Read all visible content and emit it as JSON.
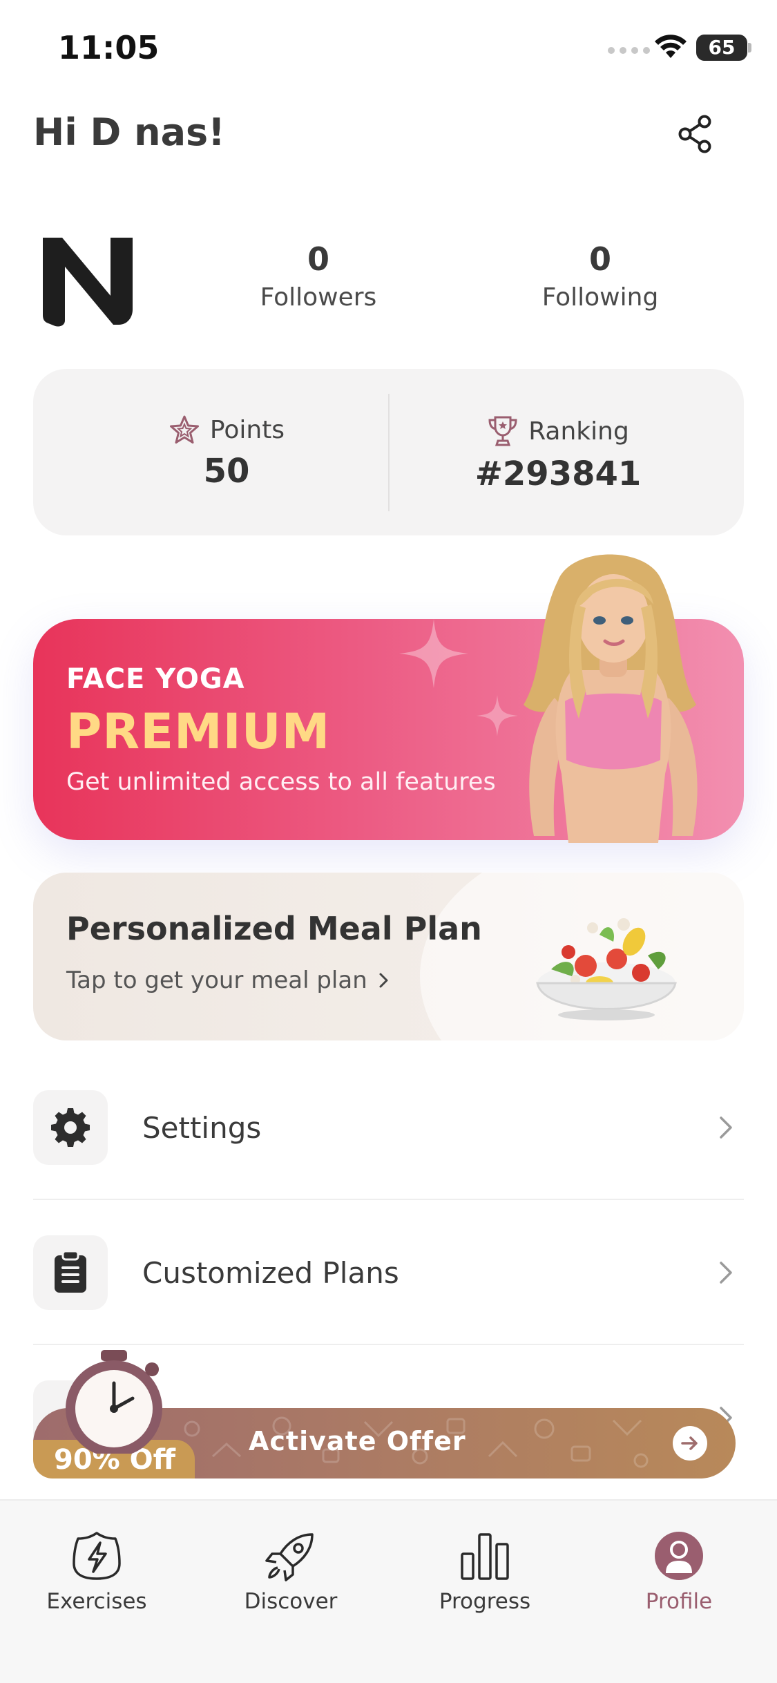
{
  "status_bar": {
    "time": "11:05",
    "battery": "65"
  },
  "header": {
    "greeting": "Hi D nas!"
  },
  "profile": {
    "followers": {
      "count": "0",
      "label": "Followers"
    },
    "following": {
      "count": "0",
      "label": "Following"
    }
  },
  "stats": {
    "points": {
      "label": "Points",
      "value": "50"
    },
    "ranking": {
      "label": "Ranking",
      "value": "#293841"
    }
  },
  "premium_banner": {
    "kicker": "FACE YOGA",
    "title": "PREMIUM",
    "subtitle": "Get unlimited access to all features"
  },
  "meal_plan": {
    "title": "Personalized Meal Plan",
    "subtitle": "Tap to get your meal plan"
  },
  "menu": {
    "items": [
      {
        "label": "Settings",
        "icon": "gear-icon"
      },
      {
        "label": "Customized Plans",
        "icon": "clipboard-icon"
      }
    ]
  },
  "offer": {
    "discount": "90% Off",
    "label": "Activate Offer"
  },
  "tabbar": {
    "tabs": [
      {
        "label": "Exercises",
        "icon": "lightning-shield-icon",
        "active": false
      },
      {
        "label": "Discover",
        "icon": "rocket-icon",
        "active": false
      },
      {
        "label": "Progress",
        "icon": "bar-chart-icon",
        "active": false
      },
      {
        "label": "Profile",
        "icon": "profile-icon",
        "active": true
      }
    ]
  },
  "colors": {
    "accent_profile": "#9a5e6f",
    "premium_gradient_start": "#e8345a",
    "premium_gold": "#ffd985",
    "offer_gold": "#c99a54"
  }
}
